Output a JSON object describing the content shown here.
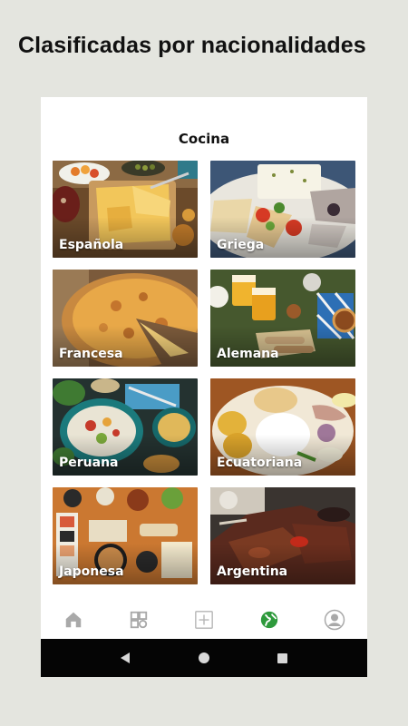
{
  "headline": "Clasificadas por nacionalidades",
  "screen": {
    "title": "Cocina",
    "cuisines": [
      {
        "label": "Española"
      },
      {
        "label": "Griega"
      },
      {
        "label": "Francesa"
      },
      {
        "label": "Alemana"
      },
      {
        "label": "Peruana"
      },
      {
        "label": "Ecuatoriana"
      },
      {
        "label": "Japonesa"
      },
      {
        "label": "Argentina"
      }
    ]
  },
  "bottom_nav": {
    "items": [
      {
        "icon": "home-icon",
        "active": false
      },
      {
        "icon": "categories-icon",
        "active": false
      },
      {
        "icon": "add-icon",
        "active": false
      },
      {
        "icon": "globe-icon",
        "active": true
      },
      {
        "icon": "profile-icon",
        "active": false
      }
    ],
    "active_color": "#2e9a3c",
    "inactive_color": "#a9a9a9"
  },
  "system_nav": [
    "back-icon",
    "home-circle-icon",
    "recents-icon"
  ]
}
